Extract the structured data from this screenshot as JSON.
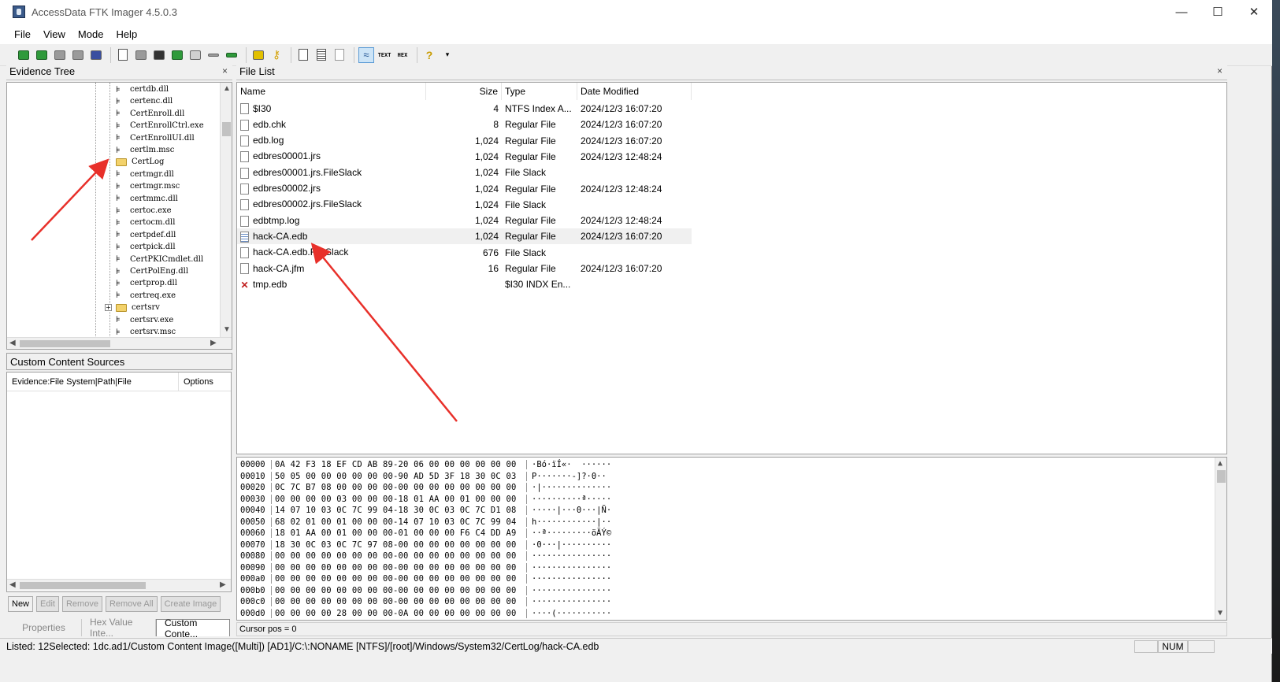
{
  "window": {
    "title": "AccessData FTK Imager 4.5.0.3",
    "controls": [
      "—",
      "☐",
      "✕"
    ]
  },
  "menu": [
    "File",
    "View",
    "Mode",
    "Help"
  ],
  "toolbar": {
    "text_icon": "TEXT",
    "hex_icon": "HEX",
    "help_icon": "?",
    "active_tool": "auto-view"
  },
  "evidence_tree": {
    "title": "Evidence Tree",
    "close": "×",
    "items": [
      {
        "label": "certdb.dll",
        "kind": "file"
      },
      {
        "label": "certenc.dll",
        "kind": "file"
      },
      {
        "label": "CertEnroll.dll",
        "kind": "file"
      },
      {
        "label": "CertEnrollCtrl.exe",
        "kind": "file"
      },
      {
        "label": "CertEnrollUI.dll",
        "kind": "file"
      },
      {
        "label": "certlm.msc",
        "kind": "file"
      },
      {
        "label": "CertLog",
        "kind": "folder"
      },
      {
        "label": "certmgr.dll",
        "kind": "file"
      },
      {
        "label": "certmgr.msc",
        "kind": "file"
      },
      {
        "label": "certmmc.dll",
        "kind": "file"
      },
      {
        "label": "certoc.exe",
        "kind": "file"
      },
      {
        "label": "certocm.dll",
        "kind": "file"
      },
      {
        "label": "certpdef.dll",
        "kind": "file"
      },
      {
        "label": "certpick.dll",
        "kind": "file"
      },
      {
        "label": "CertPKICmdlet.dll",
        "kind": "file"
      },
      {
        "label": "CertPolEng.dll",
        "kind": "file"
      },
      {
        "label": "certprop.dll",
        "kind": "file"
      },
      {
        "label": "certreq.exe",
        "kind": "file"
      },
      {
        "label": "certsrv",
        "kind": "folder",
        "expandable": true
      },
      {
        "label": "certsrv.exe",
        "kind": "file"
      },
      {
        "label": "certsrv.msc",
        "kind": "file"
      }
    ]
  },
  "custom_content": {
    "title": "Custom Content Sources",
    "col_evidence": "Evidence:File System|Path|File",
    "col_options": "Options",
    "buttons": [
      "New",
      "Edit",
      "Remove",
      "Remove All",
      "Create Image"
    ]
  },
  "bottom_tabs": [
    "Properties",
    "Hex Value Inte...",
    "Custom Conte..."
  ],
  "file_list": {
    "title": "File List",
    "close": "×",
    "columns": [
      "Name",
      "Size",
      "Type",
      "Date Modified"
    ],
    "rows": [
      {
        "name": "$I30",
        "size": "4",
        "type": "NTFS Index A...",
        "date": "2024/12/3 16:07:20",
        "icon": "file"
      },
      {
        "name": "edb.chk",
        "size": "8",
        "type": "Regular File",
        "date": "2024/12/3 16:07:20",
        "icon": "file"
      },
      {
        "name": "edb.log",
        "size": "1,024",
        "type": "Regular File",
        "date": "2024/12/3 16:07:20",
        "icon": "file"
      },
      {
        "name": "edbres00001.jrs",
        "size": "1,024",
        "type": "Regular File",
        "date": "2024/12/3 12:48:24",
        "icon": "file"
      },
      {
        "name": "edbres00001.jrs.FileSlack",
        "size": "1,024",
        "type": "File Slack",
        "date": "",
        "icon": "file"
      },
      {
        "name": "edbres00002.jrs",
        "size": "1,024",
        "type": "Regular File",
        "date": "2024/12/3 12:48:24",
        "icon": "file"
      },
      {
        "name": "edbres00002.jrs.FileSlack",
        "size": "1,024",
        "type": "File Slack",
        "date": "",
        "icon": "file"
      },
      {
        "name": "edbtmp.log",
        "size": "1,024",
        "type": "Regular File",
        "date": "2024/12/3 12:48:24",
        "icon": "file"
      },
      {
        "name": "hack-CA.edb",
        "size": "1,024",
        "type": "Regular File",
        "date": "2024/12/3 16:07:20",
        "icon": "db",
        "selected": true
      },
      {
        "name": "hack-CA.edb.FileSlack",
        "size": "676",
        "type": "File Slack",
        "date": "",
        "icon": "file"
      },
      {
        "name": "hack-CA.jfm",
        "size": "16",
        "type": "Regular File",
        "date": "2024/12/3 16:07:20",
        "icon": "file"
      },
      {
        "name": "tmp.edb",
        "size": "",
        "type": "$I30 INDX En...",
        "date": "",
        "icon": "deleted"
      }
    ]
  },
  "hex": {
    "rows": [
      {
        "off": "00000",
        "bytes": "0A 42 F3 18 EF CD AB 89-20 06 00 00 00 00 00 00",
        "ascii": "·Bó·ïÍ«·  ······"
      },
      {
        "off": "00010",
        "bytes": "50 05 00 00 00 00 00 00-90 AD 5D 3F 18 30 0C 03",
        "ascii": "P·······-]?·0··"
      },
      {
        "off": "00020",
        "bytes": "0C 7C B7 08 00 00 00 00-00 00 00 00 00 00 00 00",
        "ascii": "·|··············"
      },
      {
        "off": "00030",
        "bytes": "00 00 00 00 03 00 00 00-18 01 AA 00 01 00 00 00",
        "ascii": "··········ª·····"
      },
      {
        "off": "00040",
        "bytes": "14 07 10 03 0C 7C 99 04-18 30 0C 03 0C 7C D1 08",
        "ascii": "·····|···0···|Ñ·"
      },
      {
        "off": "00050",
        "bytes": "68 02 01 00 01 00 00 00-14 07 10 03 0C 7C 99 04",
        "ascii": "h············|··"
      },
      {
        "off": "00060",
        "bytes": "18 01 AA 00 01 00 00 00-01 00 00 00 F6 C4 DD A9",
        "ascii": "··ª·········öÄÝ©"
      },
      {
        "off": "00070",
        "bytes": "18 30 0C 03 0C 7C 97 08-00 00 00 00 00 00 00 00",
        "ascii": "·0···|··········"
      },
      {
        "off": "00080",
        "bytes": "00 00 00 00 00 00 00 00-00 00 00 00 00 00 00 00",
        "ascii": "················"
      },
      {
        "off": "00090",
        "bytes": "00 00 00 00 00 00 00 00-00 00 00 00 00 00 00 00",
        "ascii": "················"
      },
      {
        "off": "000a0",
        "bytes": "00 00 00 00 00 00 00 00-00 00 00 00 00 00 00 00",
        "ascii": "················"
      },
      {
        "off": "000b0",
        "bytes": "00 00 00 00 00 00 00 00-00 00 00 00 00 00 00 00",
        "ascii": "················"
      },
      {
        "off": "000c0",
        "bytes": "00 00 00 00 00 00 00 00-00 00 00 00 00 00 00 00",
        "ascii": "················"
      },
      {
        "off": "000d0",
        "bytes": "00 00 00 00 28 00 00 00-0A 00 00 00 00 00 00 00",
        "ascii": "····(···········"
      }
    ],
    "cursor_pos": "Cursor pos = 0"
  },
  "statusbar": {
    "text": "Listed: 12Selected: 1dc.ad1/Custom Content Image([Multi]) [AD1]/C:\\:NONAME [NTFS]/[root]/Windows/System32/CertLog/hack-CA.edb",
    "num": "NUM"
  },
  "colors": {
    "annotation_arrow": "#e8302a",
    "selection": "#f0f0f0",
    "toolbar_active": "#cce4f7"
  }
}
